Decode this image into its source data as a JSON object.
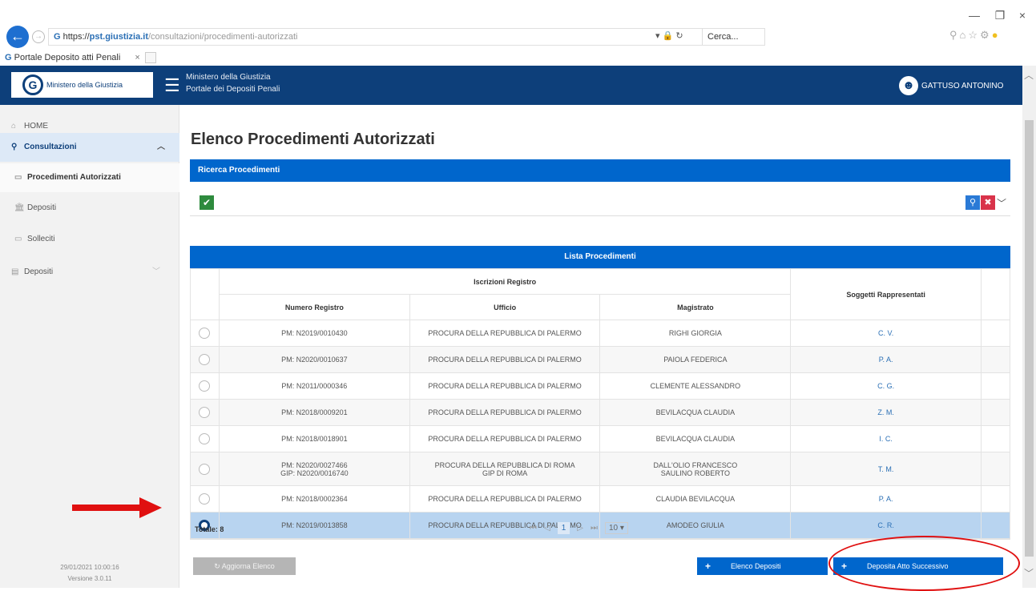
{
  "browser": {
    "url_prefix": "https://",
    "url_host": "pst.giustizia.it",
    "url_path": "/consultazioni/procedimenti-autorizzati",
    "search_placeholder": "Cerca...",
    "tab_title": "Portale Deposito atti Penali",
    "tab_close": "×",
    "window_min": "—",
    "window_max": "❐",
    "window_close": "×"
  },
  "header": {
    "logo_text": "Ministero della Giustizia",
    "line1": "Ministero della Giustizia",
    "line2": "Portale dei Depositi Penali",
    "user": "GATTUSO ANTONINO"
  },
  "sidebar": {
    "items": [
      {
        "label": "HOME"
      },
      {
        "label": "Consultazioni"
      },
      {
        "label": "Procedimenti Autorizzati"
      },
      {
        "label": "Depositi"
      },
      {
        "label": "Solleciti"
      },
      {
        "label": "Depositi"
      }
    ],
    "timestamp": "29/01/2021 10:00:16",
    "version": "Versione 3.0.11"
  },
  "main": {
    "title": "Elenco Procedimenti Autorizzati",
    "search_panel_title": "Ricerca Procedimenti",
    "list_panel_title": "Lista Procedimenti",
    "columns": {
      "group": "Iscrizioni Registro",
      "numero": "Numero Registro",
      "ufficio": "Ufficio",
      "magistrato": "Magistrato",
      "soggetti": "Soggetti Rappresentati"
    },
    "rows": [
      {
        "numero": "PM: N2019/0010430",
        "numero2": "",
        "ufficio": "PROCURA DELLA REPUBBLICA DI PALERMO",
        "ufficio2": "",
        "magistrato": "RIGHI GIORGIA",
        "magistrato2": "",
        "soggetti": "C. V."
      },
      {
        "numero": "PM: N2020/0010637",
        "numero2": "",
        "ufficio": "PROCURA DELLA REPUBBLICA DI PALERMO",
        "ufficio2": "",
        "magistrato": "PAIOLA FEDERICA",
        "magistrato2": "",
        "soggetti": "P. A."
      },
      {
        "numero": "PM: N2011/0000346",
        "numero2": "",
        "ufficio": "PROCURA DELLA REPUBBLICA DI PALERMO",
        "ufficio2": "",
        "magistrato": "CLEMENTE ALESSANDRO",
        "magistrato2": "",
        "soggetti": "C. G."
      },
      {
        "numero": "PM: N2018/0009201",
        "numero2": "",
        "ufficio": "PROCURA DELLA REPUBBLICA DI PALERMO",
        "ufficio2": "",
        "magistrato": "BEVILACQUA CLAUDIA",
        "magistrato2": "",
        "soggetti": "Z. M."
      },
      {
        "numero": "PM: N2018/0018901",
        "numero2": "",
        "ufficio": "PROCURA DELLA REPUBBLICA DI PALERMO",
        "ufficio2": "",
        "magistrato": "BEVILACQUA CLAUDIA",
        "magistrato2": "",
        "soggetti": "I. C."
      },
      {
        "numero": "PM: N2020/0027466",
        "numero2": "GIP: N2020/0016740",
        "ufficio": "PROCURA DELLA REPUBBLICA DI ROMA",
        "ufficio2": "GIP DI ROMA",
        "magistrato": "DALL'OLIO FRANCESCO",
        "magistrato2": "SAULINO ROBERTO",
        "soggetti": "T. M."
      },
      {
        "numero": "PM: N2018/0002364",
        "numero2": "",
        "ufficio": "PROCURA DELLA REPUBBLICA DI PALERMO",
        "ufficio2": "",
        "magistrato": "CLAUDIA BEVILACQUA",
        "magistrato2": "",
        "soggetti": "P. A."
      },
      {
        "numero": "PM: N2019/0013858",
        "numero2": "",
        "ufficio": "PROCURA DELLA REPUBBLICA DI PALERMO",
        "ufficio2": "",
        "magistrato": "AMODEO GIULIA",
        "magistrato2": "",
        "soggetti": "C. R."
      }
    ],
    "selected_row": 8,
    "totale": "Totale: 8",
    "pager": {
      "first": "⏮",
      "prev": "◁",
      "page": "1",
      "next": "▷",
      "last": "⏭",
      "size": "10 ▾"
    },
    "buttons": {
      "aggiorna": "Aggiorna Elenco",
      "elenco": "Elenco Depositi",
      "deposita": "Deposita Atto Successivo"
    }
  },
  "colors": {
    "header": "#0d3f7a",
    "panel": "#0066cc",
    "selected_row": "#b8d4f0",
    "annotation": "#e01010"
  }
}
